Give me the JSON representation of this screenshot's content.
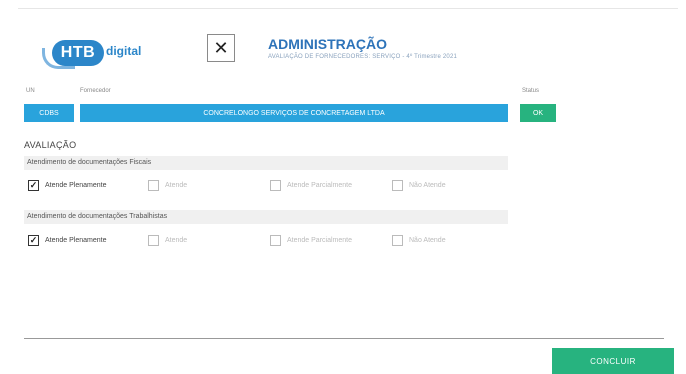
{
  "brand": {
    "logo_text": "HTB",
    "logo_suffix": "digital",
    "color": "#2c86c9"
  },
  "header": {
    "close_symbol": "✕",
    "title": "ADMINISTRAÇÃO",
    "subtitle": "AVALIAÇÃO DE FORNECEDORES: SERVIÇO - 4º Trimestre 2021"
  },
  "fields": {
    "un_label": "UN",
    "un_value": "CDBS",
    "supplier_label": "Fornecedor",
    "supplier_value": "CONCRELONGO SERVIÇOS DE CONCRETAGEM LTDA",
    "status_label": "Status",
    "status_value": "OK"
  },
  "evaluation": {
    "section_title": "AVALIAÇÃO",
    "groups": [
      {
        "title": "Atendimento de documentações Fiscais",
        "options": [
          {
            "label": "Atende Plenamente",
            "checked": true
          },
          {
            "label": "Atende",
            "checked": false
          },
          {
            "label": "Atende Parcialmente",
            "checked": false
          },
          {
            "label": "Não Atende",
            "checked": false
          }
        ]
      },
      {
        "title": "Atendimento de documentações Trabalhistas",
        "options": [
          {
            "label": "Atende Plenamente",
            "checked": true
          },
          {
            "label": "Atende",
            "checked": false
          },
          {
            "label": "Atende Parcialmente",
            "checked": false
          },
          {
            "label": "Não Atende",
            "checked": false
          }
        ]
      }
    ]
  },
  "footer": {
    "conclude_label": "CONCLUIR"
  },
  "colors": {
    "accent": "#29a3dc",
    "success": "#27b37f",
    "title": "#2d73b9"
  },
  "icons": {
    "close": "close-icon",
    "check": "check-icon"
  }
}
